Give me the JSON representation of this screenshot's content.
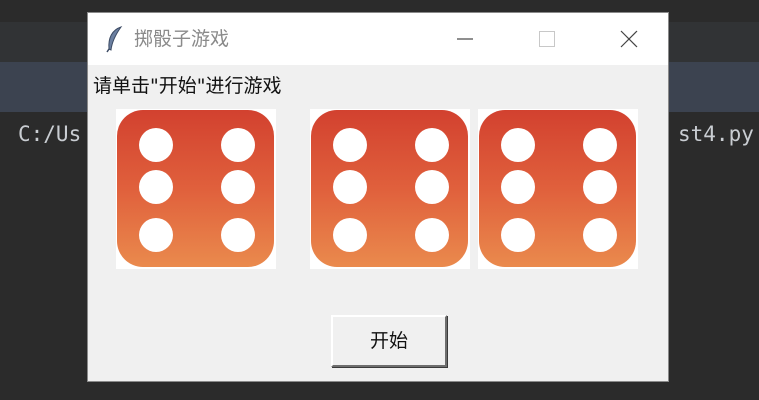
{
  "background_ide": {
    "path_text_left": "C:/Us",
    "path_text_right": "st4.py"
  },
  "window": {
    "title": "掷骰子游戏",
    "icon": "feather-icon",
    "controls": {
      "minimize": "minimize-icon",
      "maximize": "maximize-icon",
      "close": "close-icon"
    }
  },
  "instruction": "请单击\"开始\"进行游戏",
  "dice": [
    {
      "value": 6,
      "face_color": "#e0603c",
      "pip_color": "#ffffff"
    },
    {
      "value": 6,
      "face_color": "#e0603c",
      "pip_color": "#ffffff"
    },
    {
      "value": 6,
      "face_color": "#e0603c",
      "pip_color": "#ffffff"
    }
  ],
  "start_button": {
    "label": "开始"
  }
}
